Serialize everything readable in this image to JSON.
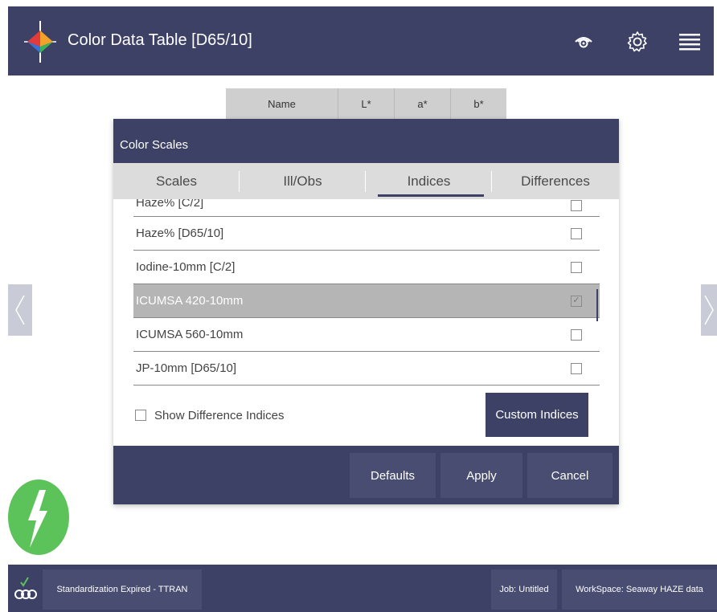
{
  "header": {
    "title": "Color Data Table [D65/10]",
    "icons": [
      "eye-icon",
      "gear-icon",
      "hamburger-menu-icon"
    ]
  },
  "background_table": {
    "columns": [
      "Name",
      "L*",
      "a*",
      "b*"
    ]
  },
  "dialog": {
    "title": "Color Scales",
    "tabs": [
      {
        "label": "Scales",
        "active": false
      },
      {
        "label": "Ill/Obs",
        "active": false
      },
      {
        "label": "Indices",
        "active": true
      },
      {
        "label": "Differences",
        "active": false
      }
    ],
    "list": [
      {
        "label": "Haze% [C/2]",
        "checked": false,
        "selected": false
      },
      {
        "label": "Haze% [D65/10]",
        "checked": false,
        "selected": false
      },
      {
        "label": "Iodine-10mm [C/2]",
        "checked": false,
        "selected": false
      },
      {
        "label": "ICUMSA 420-10mm",
        "checked": true,
        "selected": true
      },
      {
        "label": "ICUMSA 560-10mm",
        "checked": false,
        "selected": false
      },
      {
        "label": "JP-10mm [D65/10]",
        "checked": false,
        "selected": false
      }
    ],
    "show_difference_label": "Show Difference Indices",
    "show_difference_checked": false,
    "custom_indices_label": "Custom Indices",
    "buttons": {
      "defaults": "Defaults",
      "apply": "Apply",
      "cancel": "Cancel"
    }
  },
  "status_bar": {
    "standardization": "Standardization Expired - TTRAN",
    "job": "Job: Untitled",
    "workspace": "WorkSpace: Seaway HAZE data"
  },
  "colors": {
    "primary": "#3d4166",
    "chip": "#494d71",
    "fab": "#5cc35a",
    "selected_row": "#b5b5b5",
    "tab_bar": "#dcdcdc"
  }
}
